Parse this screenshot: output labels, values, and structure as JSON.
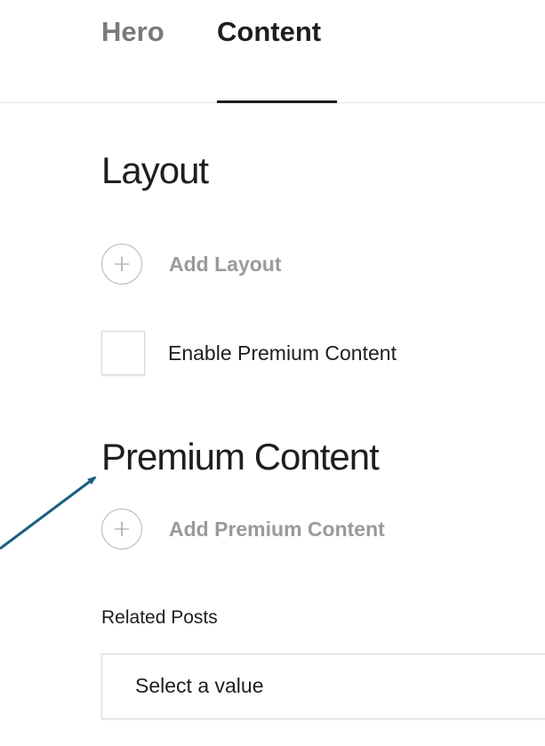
{
  "tabs": [
    {
      "label": "Hero",
      "active": false
    },
    {
      "label": "Content",
      "active": true
    }
  ],
  "layout_section": {
    "heading": "Layout",
    "add_label": "Add Layout",
    "add_icon": "plus-icon"
  },
  "premium_toggle": {
    "label": "Enable Premium Content",
    "checked": false
  },
  "premium_section": {
    "heading": "Premium Content",
    "add_label": "Add Premium Content",
    "add_icon": "plus-icon"
  },
  "related_posts": {
    "label": "Related Posts",
    "value": "Select a value"
  },
  "icons": {
    "plus": "+"
  },
  "colors": {
    "text": "#1e1e1e",
    "muted": "#9a9a9a",
    "inactive_tab": "#7a7a7a",
    "annotation_arrow": "#1b5f80"
  }
}
